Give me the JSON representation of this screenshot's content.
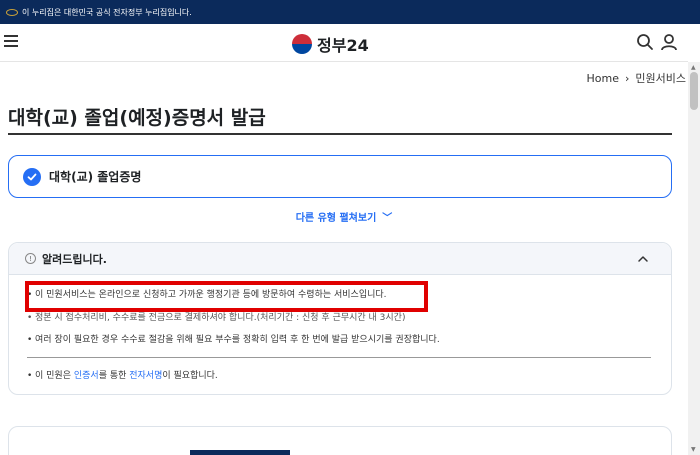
{
  "banner": {
    "text": "이 누리집은 대한민국 공식 전자정부 누리집입니다."
  },
  "header": {
    "logo_text": "정부24"
  },
  "breadcrumb": {
    "home": "Home",
    "separator": "›",
    "current": "민원서비스"
  },
  "page": {
    "title": "대학(교) 졸업(예정)증명서 발급"
  },
  "option": {
    "label": "대학(교) 졸업증명"
  },
  "more": {
    "label": "다른 유형 펼쳐보기",
    "chevron": "﹀"
  },
  "notice": {
    "info_glyph": "!",
    "title": "알려드립니다.",
    "items": [
      "이 민원서비스는 온라인으로 신청하고 가까운 행정기관 등에 방문하여 수령하는 서비스입니다.",
      "정본 시 접수처리비, 수수료를 전금으로 결제하셔야 합니다.(처리기간 : 신청 후 근무시간 내 3시간)",
      "여러 장이 필요한 경우 수수료 절감을 위해 필요 부수를 정확히 입력 후 한 번에 발급 받으시기를 권장합니다."
    ],
    "cert_prefix": "이 민원은 ",
    "cert_link1": "인증서",
    "cert_mid": "를 통한 ",
    "cert_link2": "전자서명",
    "cert_suffix": "이 필요합니다."
  },
  "colors": {
    "accent": "#256ef4",
    "banner_bg": "#0b2a5b",
    "highlight": "#e00000"
  }
}
